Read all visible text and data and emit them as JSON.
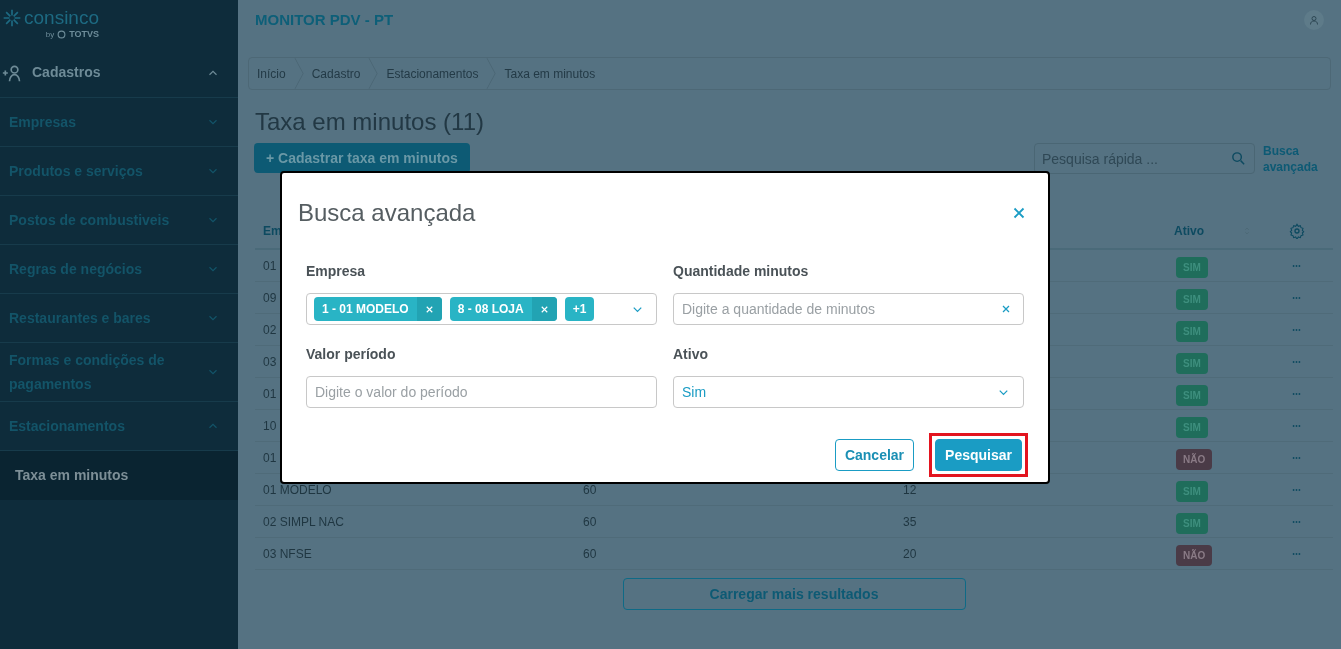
{
  "logo": {
    "name": "consinco",
    "byline": "by",
    "brand": "TOTVS"
  },
  "sidebar": {
    "items": [
      {
        "label": "Cadastros",
        "kind": "section",
        "expanded": true
      },
      {
        "label": "Empresas",
        "kind": "item",
        "expanded": false
      },
      {
        "label": "Produtos e serviços",
        "kind": "item",
        "expanded": false
      },
      {
        "label": "Postos de combustiveis",
        "kind": "item",
        "expanded": false
      },
      {
        "label": "Regras de negócios",
        "kind": "item",
        "expanded": false
      },
      {
        "label": "Restaurantes e bares",
        "kind": "item",
        "expanded": false
      },
      {
        "label": "Formas e condições de pagamentos",
        "kind": "item",
        "expanded": false
      },
      {
        "label": "Estacionamentos",
        "kind": "item",
        "expanded": true,
        "children": [
          {
            "label": "Taxa em minutos",
            "selected": true
          }
        ]
      }
    ]
  },
  "header": {
    "title": "MONITOR PDV - PT"
  },
  "breadcrumb": [
    "Início",
    "Cadastro",
    "Estacionamentos",
    "Taxa em minutos"
  ],
  "page": {
    "title": "Taxa em minutos (11)",
    "add_button": "+ Cadastrar taxa em minutos",
    "search": {
      "placeholder": "Pesquisa rápida ..."
    },
    "advanced_link": "Busca avançada"
  },
  "table": {
    "columns": [
      "Em",
      "",
      "",
      "Ativo"
    ],
    "rows": [
      {
        "column_1": "01",
        "ativo": "SIM",
        "active": true
      },
      {
        "column_1": "09",
        "ativo": "SIM",
        "active": true
      },
      {
        "column_1": "02",
        "ativo": "SIM",
        "active": true
      },
      {
        "column_1": "03",
        "ativo": "SIM",
        "active": true
      },
      {
        "column_1": "01",
        "ativo": "SIM",
        "active": true
      },
      {
        "column_1": "10",
        "ativo": "SIM",
        "active": true
      },
      {
        "column_1": "01",
        "ativo": "NÃO",
        "active": false
      },
      {
        "column_1": "01 MODELO",
        "column_2": "60",
        "column_3": "12",
        "ativo": "SIM",
        "active": true
      },
      {
        "column_1": "02 SIMPL NAC",
        "column_2": "60",
        "column_3": "35",
        "ativo": "SIM",
        "active": true
      },
      {
        "column_1": "03 NFSE",
        "column_2": "60",
        "column_3": "20",
        "ativo": "NÃO",
        "active": false
      }
    ],
    "load_more": "Carregar mais resultados"
  },
  "modal": {
    "title": "Busca avançada",
    "fields": [
      {
        "label": "Empresa",
        "kind": "multiselect",
        "chips": [
          {
            "text": "1 - 01 MODELO",
            "removable": true
          },
          {
            "text": "8 - 08 LOJA",
            "removable": true
          },
          {
            "text": "+1",
            "removable": false
          }
        ]
      },
      {
        "label": "Quantidade minutos",
        "kind": "text",
        "placeholder": "Digite a quantidade de minutos",
        "clearable": true
      },
      {
        "label": "Valor período",
        "kind": "text",
        "placeholder": "Digite o valor do período",
        "clearable": false
      },
      {
        "label": "Ativo",
        "kind": "select",
        "value": "Sim"
      }
    ],
    "buttons": [
      {
        "label": "Cancelar",
        "kind": "secondary",
        "highlighted": false
      },
      {
        "label": "Pesquisar",
        "kind": "primary",
        "highlighted": true
      }
    ]
  }
}
